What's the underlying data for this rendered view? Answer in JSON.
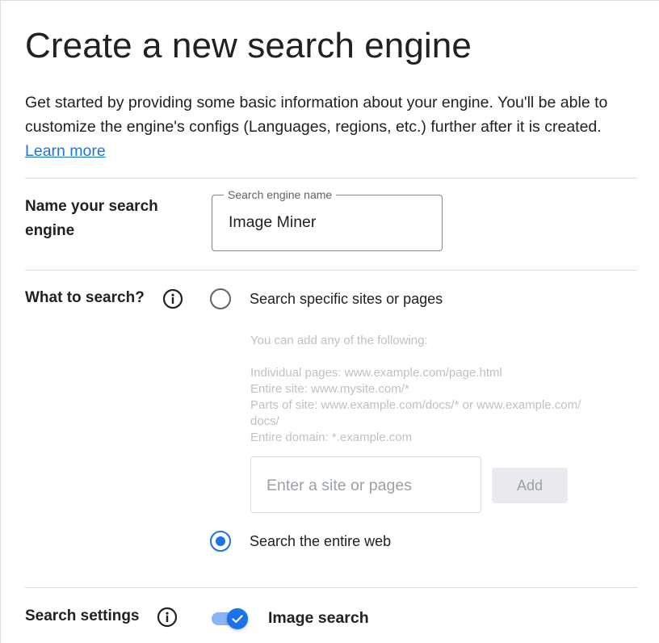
{
  "page": {
    "title": "Create a new search engine",
    "intro": "Get started by providing some basic information about your engine. You'll be able to customize the engine's configs (Languages, regions, etc.) further after it is created.",
    "learn_more": "Learn more"
  },
  "name_section": {
    "label_line1": "Name your search",
    "label_line2": "engine",
    "field_label": "Search engine name",
    "field_value": "Image Miner"
  },
  "what_section": {
    "label": "What to search?",
    "info_icon": "info-icon",
    "option_specific": "Search specific sites or pages",
    "option_specific_selected": false,
    "hint_lines": [
      "You can add any of the following:",
      "Individual pages: www.example.com/page.html",
      "Entire site: www.mysite.com/*",
      "Parts of site: www.example.com/docs/* or www.example.com/",
      "docs/",
      "Entire domain: *.example.com"
    ],
    "site_input_placeholder": "Enter a site or pages",
    "add_button": "Add",
    "option_entire_web": "Search the entire web",
    "option_entire_web_selected": true
  },
  "settings_section": {
    "label": "Search settings",
    "info_icon": "info-icon",
    "image_search_label": "Image search",
    "image_search_enabled": true
  },
  "colors": {
    "accent": "#1a73e8",
    "text": "#202124",
    "divider": "#dadce0",
    "hint": "#bdc1c6"
  }
}
